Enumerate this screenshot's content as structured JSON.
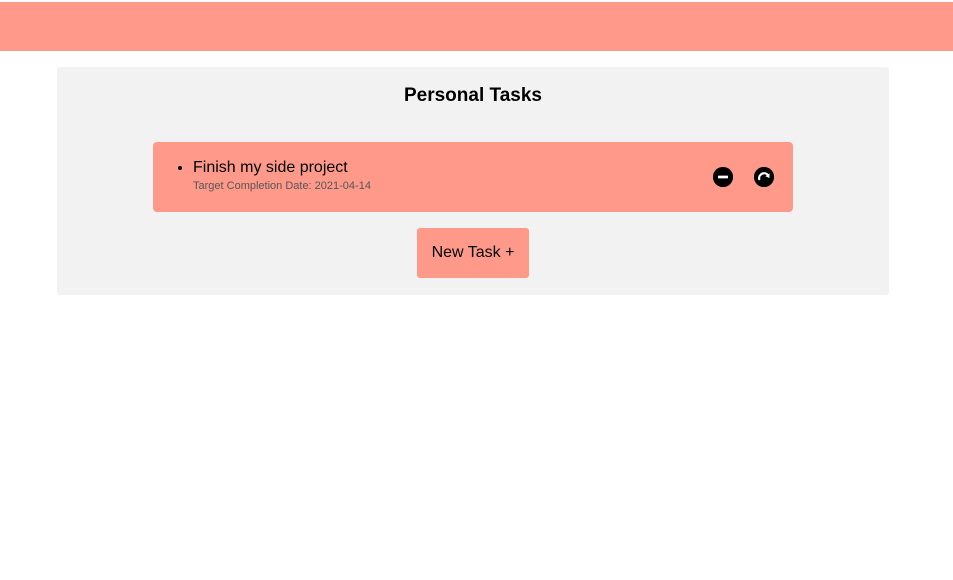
{
  "colors": {
    "accent": "#ff9a8b",
    "panel_bg": "#f2f2f2"
  },
  "panel": {
    "title": "Personal Tasks"
  },
  "tasks": [
    {
      "name": "Finish my side project",
      "date_label": "Target Completion Date: 2021-04-14",
      "actions": [
        "remove-icon",
        "redo-icon"
      ]
    }
  ],
  "new_task_button": {
    "label": "New Task +"
  }
}
